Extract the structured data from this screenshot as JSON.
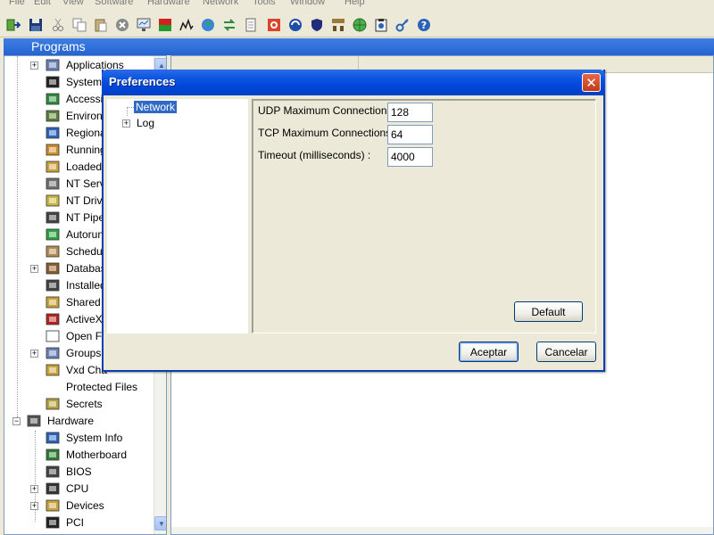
{
  "menu": [
    "File",
    "Edit",
    "View",
    "Software",
    "Hardware",
    "Network",
    "Tools",
    "Window",
    "Help"
  ],
  "toolbar_icons": [
    "exit-icon",
    "save-icon",
    "cut-icon",
    "copy-icon",
    "paste-icon",
    "stop-icon",
    "report-icon",
    "color-icon",
    "chart-icon",
    "globe-icon",
    "refresh-icon",
    "document-icon",
    "target-icon",
    "network-icon",
    "shield-icon",
    "hierarchy-icon",
    "world-icon",
    "clipboard-icon",
    "key-icon",
    "help-icon"
  ],
  "header": {
    "title": "Programs"
  },
  "tree": {
    "items": [
      {
        "label": "Applications",
        "expander": "+",
        "icon": "applications-icon",
        "color": "#6a7fb5"
      },
      {
        "label": "System",
        "expander": "",
        "icon": "console-icon",
        "color": "#222222"
      },
      {
        "label": "Accessib",
        "expander": "",
        "icon": "accessibility-icon",
        "color": "#2e8b3e"
      },
      {
        "label": "Environm",
        "expander": "",
        "icon": "environment-icon",
        "color": "#5c7d3a"
      },
      {
        "label": "Regiona",
        "expander": "",
        "icon": "globe-icon",
        "color": "#2c63b8"
      },
      {
        "label": "Running",
        "expander": "",
        "icon": "running-icon",
        "color": "#c98b2b"
      },
      {
        "label": "Loaded",
        "expander": "",
        "icon": "module-icon",
        "color": "#c9a13a"
      },
      {
        "label": "NT Serv",
        "expander": "",
        "icon": "gears-icon",
        "color": "#707070"
      },
      {
        "label": "NT Drive",
        "expander": "",
        "icon": "driver-icon",
        "color": "#c7b441"
      },
      {
        "label": "NT Pipes",
        "expander": "",
        "icon": "pipe-icon",
        "color": "#444444"
      },
      {
        "label": "Autorun",
        "expander": "",
        "icon": "autorun-icon",
        "color": "#2ea043"
      },
      {
        "label": "Schedule",
        "expander": "",
        "icon": "schedule-icon",
        "color": "#b08a52"
      },
      {
        "label": "Databas",
        "expander": "+",
        "icon": "database-icon",
        "color": "#8b5a2b"
      },
      {
        "label": "Installed",
        "expander": "",
        "icon": "installed-icon",
        "color": "#444444"
      },
      {
        "label": "Shared D",
        "expander": "",
        "icon": "shared-icon",
        "color": "#c9a13a"
      },
      {
        "label": "ActiveX",
        "expander": "",
        "icon": "activex-icon",
        "color": "#b22222"
      },
      {
        "label": "Open Fil",
        "expander": "",
        "icon": "open-file-icon",
        "color": "#ffffff"
      },
      {
        "label": "Groups a",
        "expander": "+",
        "icon": "groups-icon",
        "color": "#6a7fb5"
      },
      {
        "label": "Vxd Cha",
        "expander": "",
        "icon": "vxd-icon",
        "color": "#c9a13a"
      },
      {
        "label": "Protected Files",
        "expander": "",
        "icon": "none",
        "color": "#ffffff"
      },
      {
        "label": "Secrets",
        "expander": "",
        "icon": "secrets-icon",
        "color": "#b0a040"
      },
      {
        "label": "Hardware",
        "expander": "−",
        "icon": "hardware-icon",
        "color": "#555555"
      },
      {
        "label": "System Info",
        "expander": "",
        "icon": "system-info-icon",
        "color": "#2c63b8"
      },
      {
        "label": "Motherboard",
        "expander": "",
        "icon": "motherboard-icon",
        "color": "#2e7d32"
      },
      {
        "label": "BIOS",
        "expander": "",
        "icon": "chip-icon",
        "color": "#444444"
      },
      {
        "label": "CPU",
        "expander": "+",
        "icon": "cpu-icon",
        "color": "#333333"
      },
      {
        "label": "Devices",
        "expander": "+",
        "icon": "devices-icon",
        "color": "#c9a13a"
      },
      {
        "label": "PCI",
        "expander": "",
        "icon": "pci-icon",
        "color": "#222222"
      }
    ]
  },
  "dialog": {
    "title": "Preferences",
    "close_glyph": "✕",
    "tree": {
      "network": "Network",
      "log": "Log"
    },
    "fields": [
      {
        "label": "UDP Maximum Connections:",
        "value": "128"
      },
      {
        "label": "TCP Maximum Connections:",
        "value": "64"
      },
      {
        "label": "Timeout (milliseconds) :",
        "value": "4000"
      }
    ],
    "default_label": "Default",
    "ok_label": "Aceptar",
    "cancel_label": "Cancelar"
  },
  "colors": {
    "title_bar": "#0054e3",
    "header_bar": "#2f6fdc",
    "selection": "#316ac5",
    "close_button": "#d4522f"
  }
}
